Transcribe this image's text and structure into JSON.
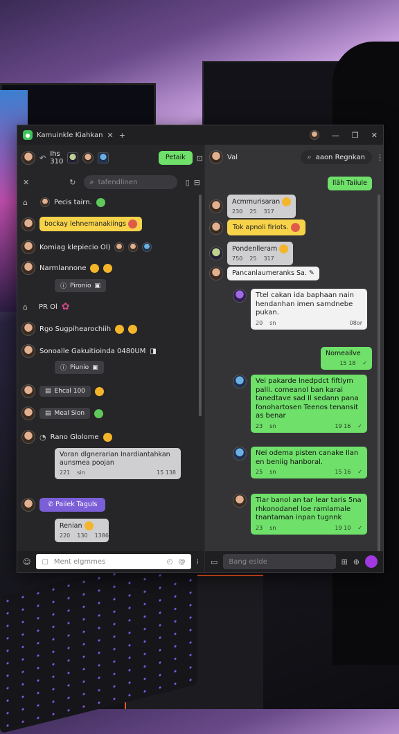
{
  "window": {
    "tab_title": "Kamuinkle Kiahkan",
    "new_tab": "+"
  },
  "left": {
    "header": {
      "name": "Ihs",
      "sub": "310",
      "primary_button": "Petaik"
    },
    "search": {
      "placeholder": "tafendlinen"
    },
    "items": [
      {
        "text": "Pecis tairn."
      },
      {
        "text": "bockay lehnemanakiings"
      },
      {
        "text": "Komiag klepiecio Ol)"
      },
      {
        "text": "Narmlannone"
      },
      {
        "text": "Pironio"
      },
      {
        "text": "PR Ol"
      },
      {
        "text": "Rgo Sugpihearochiih"
      },
      {
        "text": "Sonoalle Gakuitioinda 0480UM"
      },
      {
        "text": "Piunio"
      },
      {
        "text": "Ehcal 100"
      },
      {
        "text": "Meal Sion"
      },
      {
        "text": "Rano Glolome"
      },
      {
        "text": "Voran dlgnerarian Inardiantahkan aunsmea poojan",
        "meta": [
          "221",
          "sin",
          "15 138"
        ]
      },
      {
        "text": "Paiiek Taguls"
      },
      {
        "text": "Renian",
        "meta": [
          "220",
          "130",
          "1386"
        ]
      }
    ],
    "composer_placeholder": "Ment elgmmes"
  },
  "right": {
    "header": {
      "name": "Val",
      "search_text": "aaon Regnkan"
    },
    "messages": [
      {
        "text": "lläh Taiiule"
      },
      {
        "text": "Acmmurisaran",
        "meta": [
          "230",
          "25",
          "317"
        ]
      },
      {
        "text": "Tok apnoli firiots."
      },
      {
        "text": "Pondenlleram",
        "meta": [
          "750",
          "25",
          "317"
        ]
      },
      {
        "text": "Pancanlaumeranks Sa."
      },
      {
        "text": "Ttel cakan ida baphaan nain hendanhan imen samdnebe pukan.",
        "meta": [
          "20",
          "sn",
          "08or"
        ]
      },
      {
        "text": "Nomeailve",
        "meta": [
          "15 18"
        ]
      },
      {
        "text": "Vei pakarde lnedpdct fiftlym palli. comeanol ban karai tanedtave sad Il sedann pana fonohartosen Teenos tenansit as benar",
        "meta": [
          "23",
          "sn",
          "19 16"
        ]
      },
      {
        "text": "Nei odema pisten canake Ilan en beniig hanboral.",
        "meta": [
          "25",
          "sn",
          "15 16"
        ]
      },
      {
        "text": "Tlar banol an tar lear taris 5na rhkonodanel loe ramlamale tnantaman inpan tugnnk",
        "meta": [
          "23",
          "sn",
          "19 10"
        ]
      }
    ],
    "composer_placeholder": "Bang eslde"
  },
  "colors": {
    "accent": "#6fe06a",
    "bg": "#2c2c2e"
  }
}
